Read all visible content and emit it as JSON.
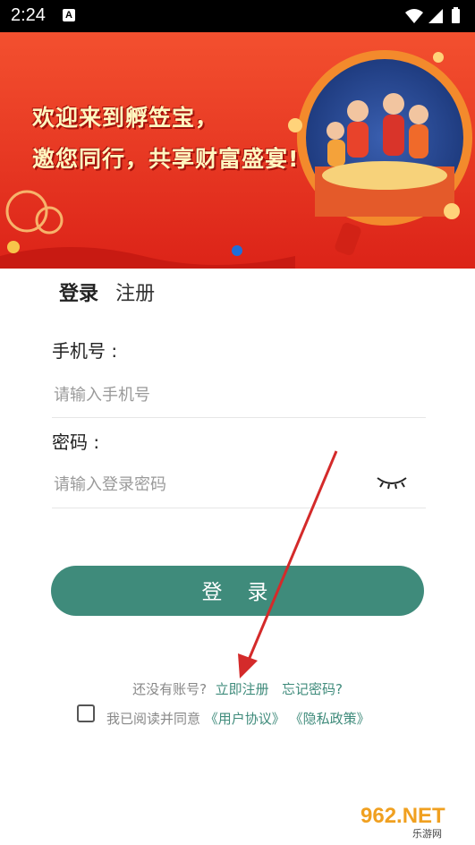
{
  "status_bar": {
    "time": "2:24",
    "notification_icon": "A",
    "icons": [
      "wifi-icon",
      "signal-icon",
      "battery-icon"
    ]
  },
  "banner": {
    "line1": "欢迎来到孵笠宝，",
    "line2": "邀您同行，共享财富盛宴!",
    "carousel_active_index": 0
  },
  "tabs": [
    {
      "label": "登录",
      "active": true
    },
    {
      "label": "注册",
      "active": false
    }
  ],
  "form": {
    "phone_label": "手机号 :",
    "phone_placeholder": "请输入手机号",
    "password_label": "密码 :",
    "password_placeholder": "请输入登录密码",
    "login_button": "登录"
  },
  "links": {
    "no_account": "还没有账号?",
    "register_now": "立即注册",
    "forgot_password": "忘记密码?"
  },
  "agreement": {
    "checked": false,
    "prefix": "我已阅读并同意",
    "user_agreement": "《用户协议》",
    "privacy_policy": "《隐私政策》"
  },
  "watermark": {
    "brand": "962.NET",
    "subtitle": "乐游网"
  },
  "colors": {
    "accent": "#3f8b7b",
    "banner_red": "#e8321f",
    "carousel_dot": "#1e6fd9",
    "annotation_arrow": "#d42a2a"
  }
}
